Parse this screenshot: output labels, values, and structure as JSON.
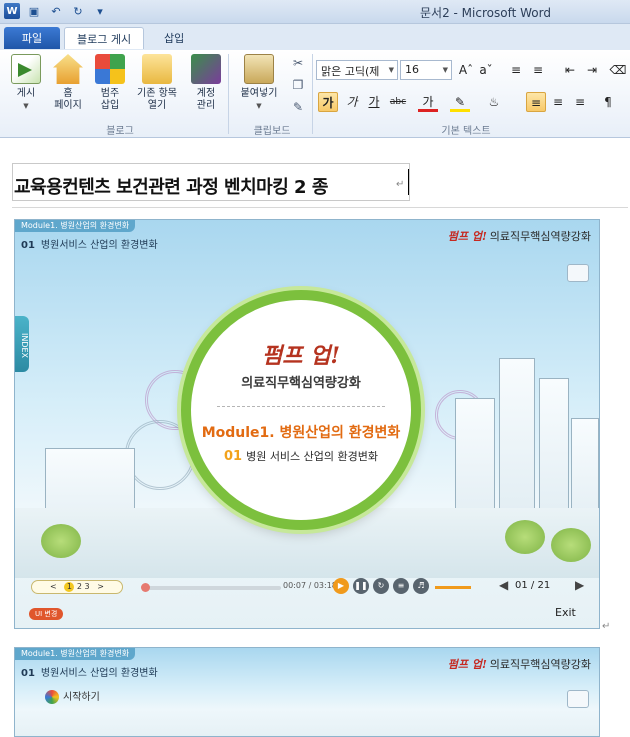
{
  "window": {
    "title": "문서2  -  Microsoft Word"
  },
  "tabs": {
    "file": "파일",
    "blog_post": "블로그 게시",
    "insert": "삽입"
  },
  "ribbon": {
    "blog_group": {
      "label": "블로그",
      "post": "게시",
      "home_line1": "홈",
      "home_line2": "페이지",
      "category_line1": "범주",
      "category_line2": "삽입",
      "open_line1": "기존 항목",
      "open_line2": "열기",
      "account_line1": "계정",
      "account_line2": "관리"
    },
    "clipboard_group": {
      "label": "클립보드",
      "paste": "붙여넣기"
    },
    "text_group": {
      "label": "기본 텍스트",
      "font_name": "맑은 고딕(제",
      "font_size": "16",
      "bold": "가",
      "italic": "가",
      "underline": "가",
      "strike": "abc",
      "font_color": "가"
    }
  },
  "document": {
    "title": "교육용컨텐츠 보건관련 과정 벤치마킹 2 종",
    "pilcrow": "↵",
    "slide1": {
      "module_tag": "Module1. 병원산업의 환경변화",
      "section_num": "01",
      "section_title": "병원서비스 산업의 환경변화",
      "brand_logo": "펌프 업!",
      "brand_text": "의료직무핵심역량강화",
      "index_tab": "INDEX",
      "circle_logo": "펌프 업!",
      "circle_subtitle": "의료직무핵심역량강화",
      "circle_module": "Module1. 병원산업의 환경변화",
      "circle_section_num": "01",
      "circle_section": "병원 서비스 산업의 환경변화",
      "pager_prev": "<",
      "pager_pages": [
        "1",
        "2",
        "3"
      ],
      "pager_next": ">",
      "time": "00:07 / 03:18",
      "page_indicator": "01 / 21",
      "exit": "Exit",
      "ui_button": "UI 변경"
    },
    "slide2": {
      "module_tag": "Module1. 병원산업의 환경변화",
      "section_num": "01",
      "section_title": "병원서비스 산업의 환경변화",
      "brand_logo": "펌프 업!",
      "brand_text": "의료직무핵심역량강화",
      "start": "시작하기"
    }
  }
}
